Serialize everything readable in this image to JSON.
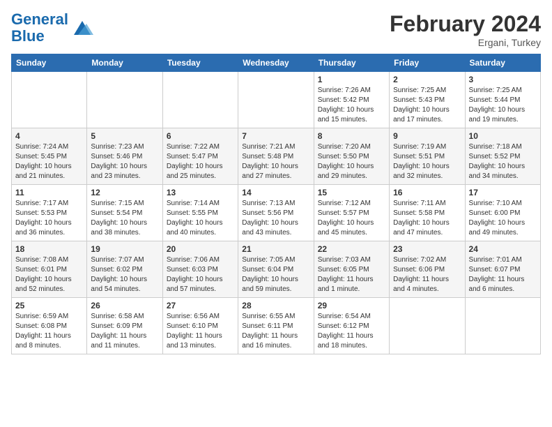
{
  "header": {
    "logo_line1": "General",
    "logo_line2": "Blue",
    "month_title": "February 2024",
    "subtitle": "Ergani, Turkey"
  },
  "weekdays": [
    "Sunday",
    "Monday",
    "Tuesday",
    "Wednesday",
    "Thursday",
    "Friday",
    "Saturday"
  ],
  "weeks": [
    [
      {
        "day": "",
        "info": ""
      },
      {
        "day": "",
        "info": ""
      },
      {
        "day": "",
        "info": ""
      },
      {
        "day": "",
        "info": ""
      },
      {
        "day": "1",
        "info": "Sunrise: 7:26 AM\nSunset: 5:42 PM\nDaylight: 10 hours\nand 15 minutes."
      },
      {
        "day": "2",
        "info": "Sunrise: 7:25 AM\nSunset: 5:43 PM\nDaylight: 10 hours\nand 17 minutes."
      },
      {
        "day": "3",
        "info": "Sunrise: 7:25 AM\nSunset: 5:44 PM\nDaylight: 10 hours\nand 19 minutes."
      }
    ],
    [
      {
        "day": "4",
        "info": "Sunrise: 7:24 AM\nSunset: 5:45 PM\nDaylight: 10 hours\nand 21 minutes."
      },
      {
        "day": "5",
        "info": "Sunrise: 7:23 AM\nSunset: 5:46 PM\nDaylight: 10 hours\nand 23 minutes."
      },
      {
        "day": "6",
        "info": "Sunrise: 7:22 AM\nSunset: 5:47 PM\nDaylight: 10 hours\nand 25 minutes."
      },
      {
        "day": "7",
        "info": "Sunrise: 7:21 AM\nSunset: 5:48 PM\nDaylight: 10 hours\nand 27 minutes."
      },
      {
        "day": "8",
        "info": "Sunrise: 7:20 AM\nSunset: 5:50 PM\nDaylight: 10 hours\nand 29 minutes."
      },
      {
        "day": "9",
        "info": "Sunrise: 7:19 AM\nSunset: 5:51 PM\nDaylight: 10 hours\nand 32 minutes."
      },
      {
        "day": "10",
        "info": "Sunrise: 7:18 AM\nSunset: 5:52 PM\nDaylight: 10 hours\nand 34 minutes."
      }
    ],
    [
      {
        "day": "11",
        "info": "Sunrise: 7:17 AM\nSunset: 5:53 PM\nDaylight: 10 hours\nand 36 minutes."
      },
      {
        "day": "12",
        "info": "Sunrise: 7:15 AM\nSunset: 5:54 PM\nDaylight: 10 hours\nand 38 minutes."
      },
      {
        "day": "13",
        "info": "Sunrise: 7:14 AM\nSunset: 5:55 PM\nDaylight: 10 hours\nand 40 minutes."
      },
      {
        "day": "14",
        "info": "Sunrise: 7:13 AM\nSunset: 5:56 PM\nDaylight: 10 hours\nand 43 minutes."
      },
      {
        "day": "15",
        "info": "Sunrise: 7:12 AM\nSunset: 5:57 PM\nDaylight: 10 hours\nand 45 minutes."
      },
      {
        "day": "16",
        "info": "Sunrise: 7:11 AM\nSunset: 5:58 PM\nDaylight: 10 hours\nand 47 minutes."
      },
      {
        "day": "17",
        "info": "Sunrise: 7:10 AM\nSunset: 6:00 PM\nDaylight: 10 hours\nand 49 minutes."
      }
    ],
    [
      {
        "day": "18",
        "info": "Sunrise: 7:08 AM\nSunset: 6:01 PM\nDaylight: 10 hours\nand 52 minutes."
      },
      {
        "day": "19",
        "info": "Sunrise: 7:07 AM\nSunset: 6:02 PM\nDaylight: 10 hours\nand 54 minutes."
      },
      {
        "day": "20",
        "info": "Sunrise: 7:06 AM\nSunset: 6:03 PM\nDaylight: 10 hours\nand 57 minutes."
      },
      {
        "day": "21",
        "info": "Sunrise: 7:05 AM\nSunset: 6:04 PM\nDaylight: 10 hours\nand 59 minutes."
      },
      {
        "day": "22",
        "info": "Sunrise: 7:03 AM\nSunset: 6:05 PM\nDaylight: 11 hours\nand 1 minute."
      },
      {
        "day": "23",
        "info": "Sunrise: 7:02 AM\nSunset: 6:06 PM\nDaylight: 11 hours\nand 4 minutes."
      },
      {
        "day": "24",
        "info": "Sunrise: 7:01 AM\nSunset: 6:07 PM\nDaylight: 11 hours\nand 6 minutes."
      }
    ],
    [
      {
        "day": "25",
        "info": "Sunrise: 6:59 AM\nSunset: 6:08 PM\nDaylight: 11 hours\nand 8 minutes."
      },
      {
        "day": "26",
        "info": "Sunrise: 6:58 AM\nSunset: 6:09 PM\nDaylight: 11 hours\nand 11 minutes."
      },
      {
        "day": "27",
        "info": "Sunrise: 6:56 AM\nSunset: 6:10 PM\nDaylight: 11 hours\nand 13 minutes."
      },
      {
        "day": "28",
        "info": "Sunrise: 6:55 AM\nSunset: 6:11 PM\nDaylight: 11 hours\nand 16 minutes."
      },
      {
        "day": "29",
        "info": "Sunrise: 6:54 AM\nSunset: 6:12 PM\nDaylight: 11 hours\nand 18 minutes."
      },
      {
        "day": "",
        "info": ""
      },
      {
        "day": "",
        "info": ""
      }
    ]
  ]
}
